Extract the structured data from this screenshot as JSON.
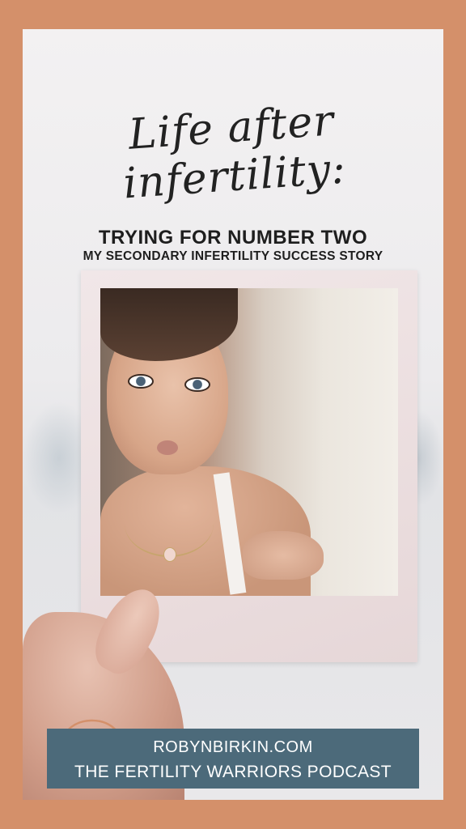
{
  "title_script": "Life after infertility:",
  "headline": "TRYING FOR NUMBER TWO",
  "subheadline": "MY SECONDARY INFERTILITY SUCCESS STORY",
  "banner": {
    "website": "ROBYNBIRKIN.COM",
    "podcast": "THE FERTILITY WARRIORS PODCAST"
  },
  "colors": {
    "frame": "#d4906a",
    "banner": "#4c6a7a",
    "icon_stroke": "#d4906a"
  },
  "icons": {
    "podcast_icon": "headphones-icon"
  }
}
